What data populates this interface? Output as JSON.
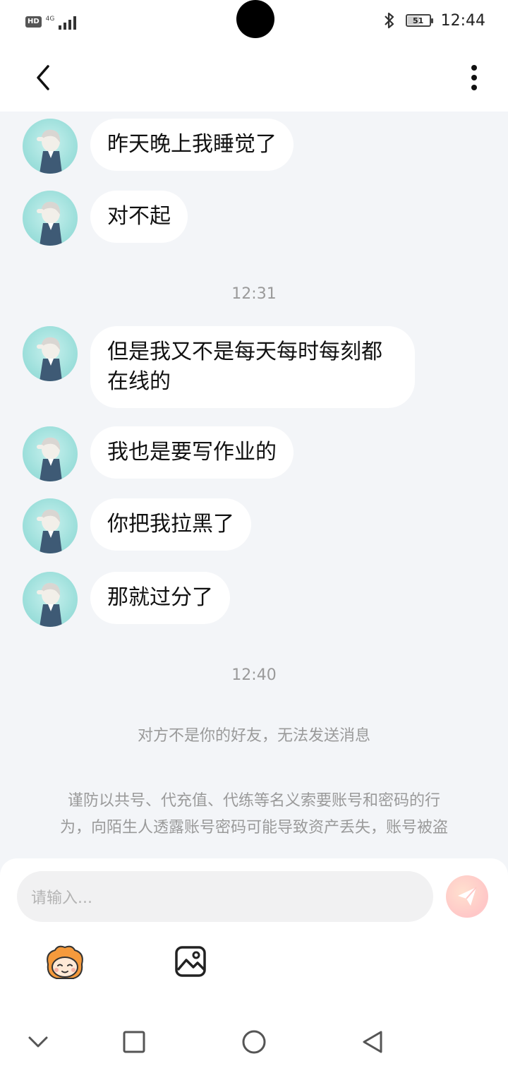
{
  "status_bar": {
    "hd": "HD",
    "network": "4G",
    "battery": "51",
    "battery_level": 0.51,
    "time": "12:44"
  },
  "header": {
    "back_icon": "chevron-left-icon",
    "more_icon": "more-vertical-icon"
  },
  "messages": [
    {
      "text": "昨天晚上我睡觉了"
    },
    {
      "text": "对不起"
    },
    {
      "text": "但是我又不是每天每时每刻都在线的"
    },
    {
      "text": "我也是要写作业的"
    },
    {
      "text": "你把我拉黑了"
    },
    {
      "text": "那就过分了"
    }
  ],
  "timestamps": [
    "12:31",
    "12:40"
  ],
  "system_notice": "对方不是你的好友，无法发送消息",
  "warning": {
    "line1": "谨防以共号、代充值、代练等名义索要账号和密码的行",
    "line2": "为，向陌生人透露账号密码可能导致资产丢失，账号被盗"
  },
  "composer": {
    "placeholder": "请输入...",
    "send_icon": "paper-plane-icon",
    "sticker_icon": "sticker-face-icon",
    "image_icon": "image-icon"
  },
  "nav": {
    "icons": [
      "chevron-down-icon",
      "square-icon",
      "circle-icon",
      "triangle-back-icon"
    ]
  },
  "colors": {
    "background": "#f3f5f8",
    "bubble": "#ffffff",
    "avatar_bg": "#9fe0dc",
    "muted_text": "#9a9a9a",
    "send_button": "#ffc7c7"
  }
}
